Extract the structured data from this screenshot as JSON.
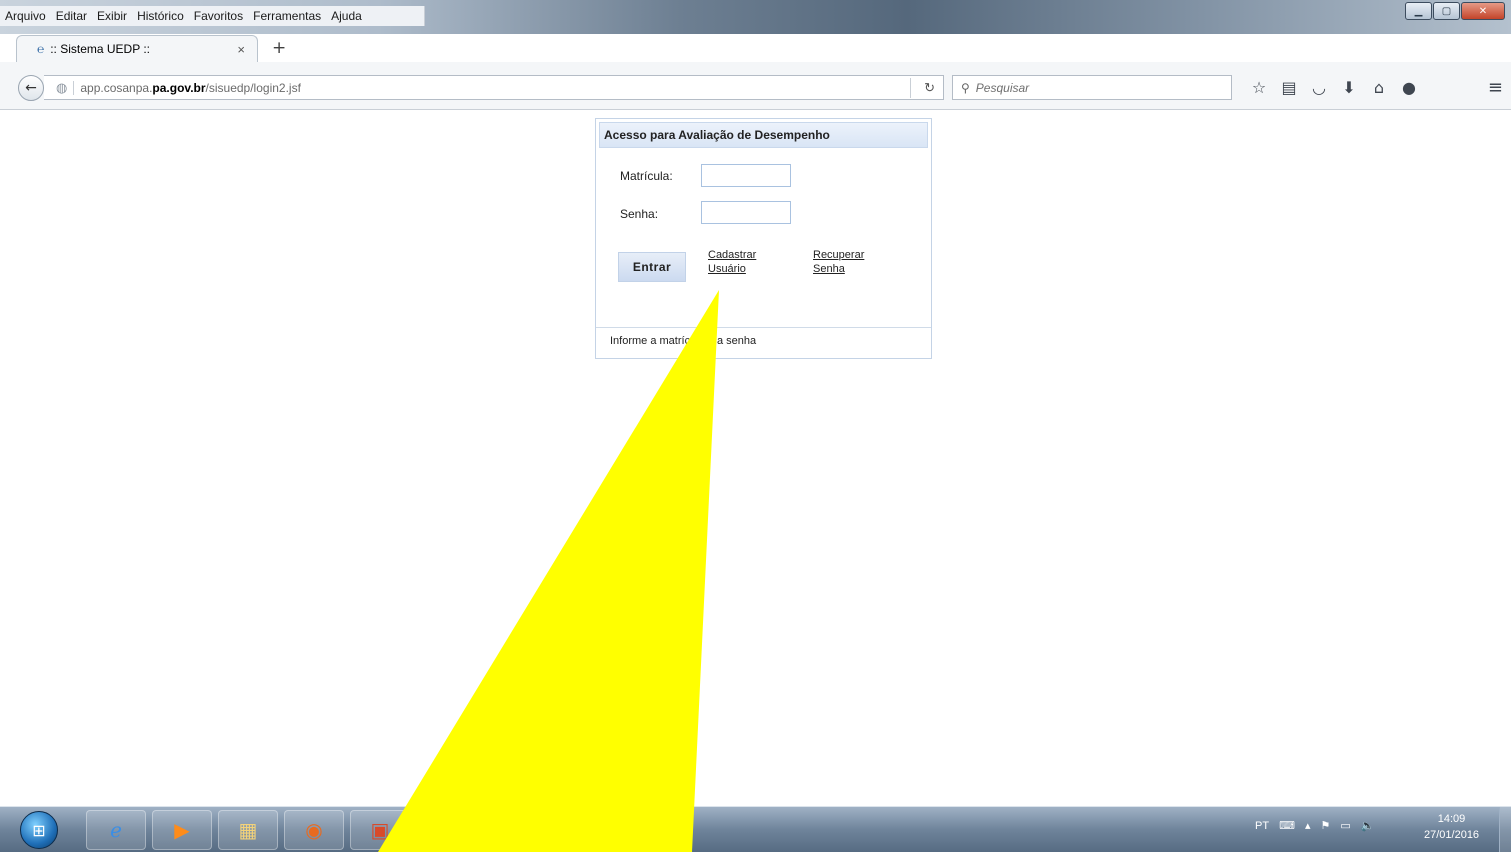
{
  "menubar": {
    "items": [
      "Arquivo",
      "Editar",
      "Exibir",
      "Histórico",
      "Favoritos",
      "Ferramentas",
      "Ajuda"
    ]
  },
  "tab": {
    "title": ":: Sistema UEDP ::",
    "close": "×",
    "new_tab": "+"
  },
  "navbar": {
    "url_pre": "app.cosanpa.",
    "url_domain": "pa.gov.br",
    "url_post": "/sisuedp/login2.jsf",
    "search_placeholder": "Pesquisar"
  },
  "login": {
    "header": "Acesso para Avaliação de Desempenho",
    "matricula_label": "Matrícula:",
    "senha_label": "Senha:",
    "entrar_label": "Entrar",
    "cadastrar_line1": "Cadastrar",
    "cadastrar_line2": "Usuário",
    "recuperar_line1": "Recuperar",
    "recuperar_line2": "Senha",
    "hint": "Informe a matrícula e a senha"
  },
  "taskbar": {
    "language": "PT",
    "time": "14:09",
    "date": "27/01/2016"
  },
  "colors": {
    "annotation": "#ffff00"
  }
}
